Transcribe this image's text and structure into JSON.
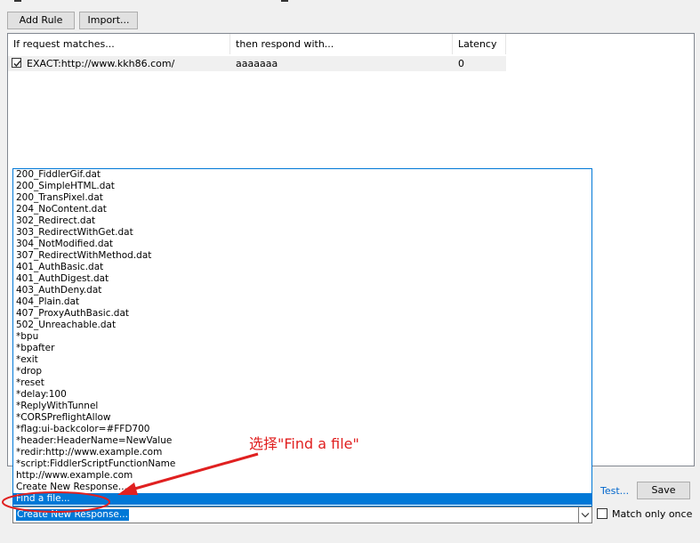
{
  "toolbar": {
    "add_rule_label": "Add Rule",
    "import_label": "Import..."
  },
  "rules_table": {
    "columns": [
      "If request matches...",
      "then respond with...",
      "Latency"
    ],
    "rows": [
      {
        "checked": true,
        "match": "EXACT:http://www.kkh86.com/",
        "response": "aaaaaaa",
        "latency": "0"
      }
    ]
  },
  "response_list": {
    "items": [
      "200_FiddlerGif.dat",
      "200_SimpleHTML.dat",
      "200_TransPixel.dat",
      "204_NoContent.dat",
      "302_Redirect.dat",
      "303_RedirectWithGet.dat",
      "304_NotModified.dat",
      "307_RedirectWithMethod.dat",
      "401_AuthBasic.dat",
      "401_AuthDigest.dat",
      "403_AuthDeny.dat",
      "404_Plain.dat",
      "407_ProxyAuthBasic.dat",
      "502_Unreachable.dat",
      "*bpu",
      "*bpafter",
      "*exit",
      "*drop",
      "*reset",
      "*delay:100",
      "*ReplyWithTunnel",
      "*CORSPreflightAllow",
      "*flag:ui-backcolor=#FFD700",
      "*header:HeaderName=NewValue",
      "*redir:http://www.example.com",
      "*script:FiddlerScriptFunctionName",
      "http://www.example.com",
      "Create New Response...",
      "Find a file..."
    ],
    "selected_index": 28
  },
  "response_combo": {
    "value": "Create New Response..."
  },
  "actions": {
    "test_label": "Test...",
    "save_label": "Save",
    "match_only_once_label": "Match only once",
    "match_only_once_checked": false
  },
  "annotation": {
    "text": "选择\"Find a file\"",
    "color": "#e02020"
  }
}
